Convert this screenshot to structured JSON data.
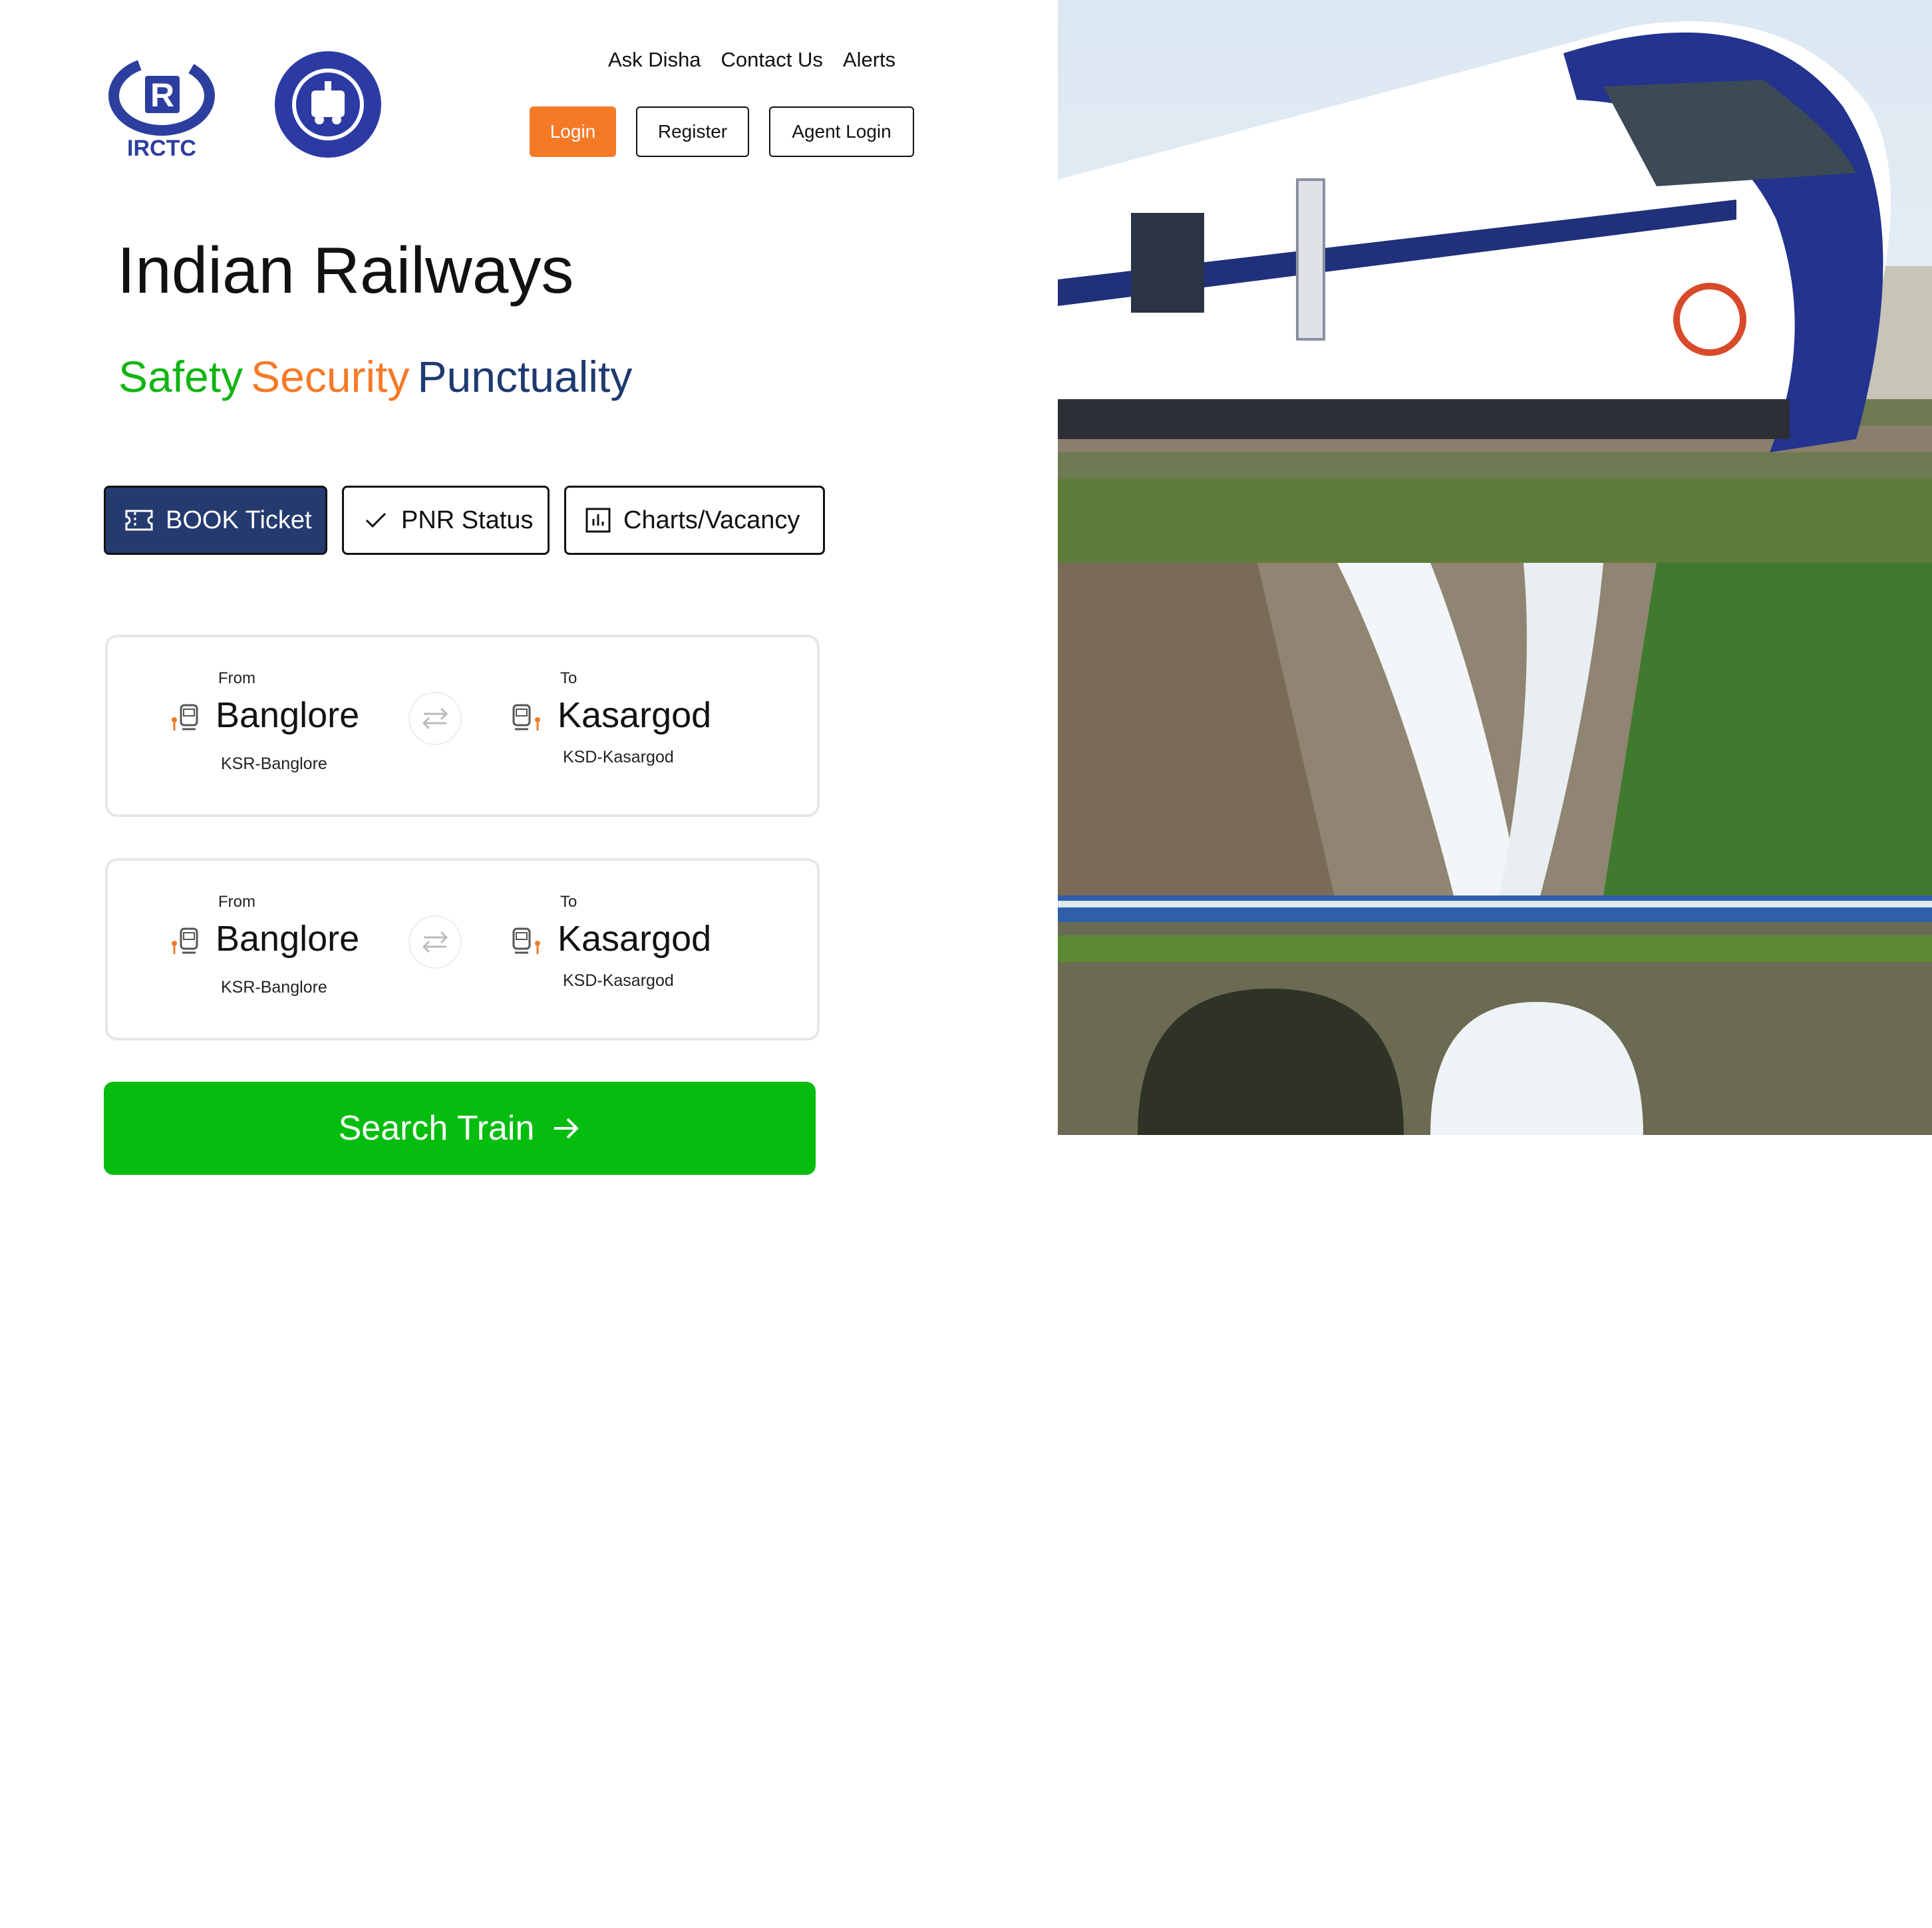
{
  "logos": {
    "irctc_text": "IRCTC"
  },
  "nav": {
    "links": [
      "Ask Disha",
      "Contact Us",
      "Alerts"
    ],
    "login_label": "Login",
    "register_label": "Register",
    "agent_login_label": "Agent Login"
  },
  "hero": {
    "title": "Indian Railways",
    "tagline": {
      "safety": "Safety",
      "security": "Security",
      "punctuality": "Punctuality"
    }
  },
  "tabs": [
    {
      "label": "BOOK Ticket",
      "icon": "ticket-icon",
      "active": true
    },
    {
      "label": "PNR Status",
      "icon": "check-icon",
      "active": false
    },
    {
      "label": "Charts/Vacancy",
      "icon": "chart-icon",
      "active": false
    }
  ],
  "journeys": [
    {
      "from": {
        "label": "From",
        "city": "Banglore",
        "code": "KSR-Banglore"
      },
      "to": {
        "label": "To",
        "city": "Kasargod",
        "code": "KSD-Kasargod"
      }
    },
    {
      "from": {
        "label": "From",
        "city": "Banglore",
        "code": "KSR-Banglore"
      },
      "to": {
        "label": "To",
        "city": "Kasargod",
        "code": "KSD-Kasargod"
      }
    }
  ],
  "search": {
    "label": "Search Train",
    "icon": "arrow-right-icon"
  },
  "colors": {
    "orange": "#f57a28",
    "navy": "#253b70",
    "green": "#04bd0e",
    "tagline_green": "#12b513",
    "tagline_navy": "#1e3a70"
  },
  "images": {
    "train": "vande-bharat-train-photo",
    "falls": "waterfall-bridge-photo"
  }
}
